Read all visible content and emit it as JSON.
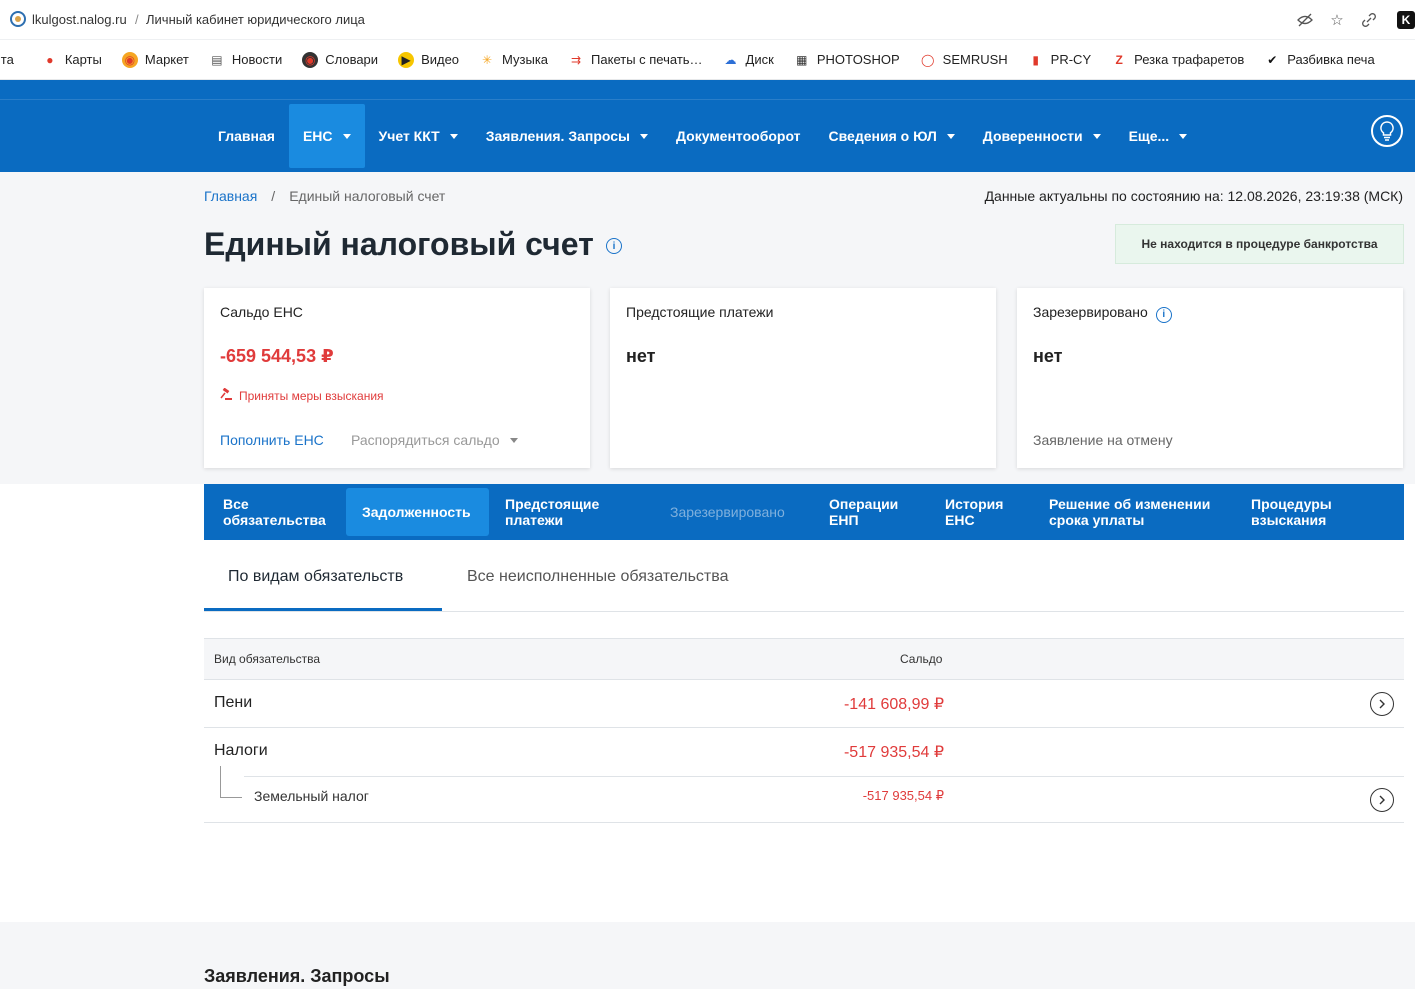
{
  "browser": {
    "domain": "lkulgost.nalog.ru",
    "separator": "/",
    "title": "Личный кабинет юридического лица"
  },
  "bookmarks": [
    {
      "label": "чта",
      "icon": "mail-icon"
    },
    {
      "label": "Карты",
      "icon": "map-pin-icon"
    },
    {
      "label": "Маркет",
      "icon": "market-icon"
    },
    {
      "label": "Новости",
      "icon": "news-icon"
    },
    {
      "label": "Словари",
      "icon": "dictionary-icon"
    },
    {
      "label": "Видео",
      "icon": "video-icon"
    },
    {
      "label": "Музыка",
      "icon": "music-icon"
    },
    {
      "label": "Пакеты с печать…",
      "icon": "package-icon"
    },
    {
      "label": "Диск",
      "icon": "disk-icon"
    },
    {
      "label": "PHOTOSHOP",
      "icon": "photoshop-icon"
    },
    {
      "label": "SEMRUSH",
      "icon": "semrush-icon"
    },
    {
      "label": "PR-CY",
      "icon": "prcy-icon"
    },
    {
      "label": "Резка трафаретов",
      "icon": "stencil-icon"
    },
    {
      "label": "Разбивка печа",
      "icon": "bird-icon"
    }
  ],
  "nav": {
    "items": [
      {
        "label": "Главная",
        "dropdown": false,
        "active": false
      },
      {
        "label": "ЕНС",
        "dropdown": true,
        "active": true
      },
      {
        "label": "Учет ККТ",
        "dropdown": true,
        "active": false
      },
      {
        "label": "Заявления. Запросы",
        "dropdown": true,
        "active": false
      },
      {
        "label": "Документооборот",
        "dropdown": false,
        "active": false
      },
      {
        "label": "Сведения о ЮЛ",
        "dropdown": true,
        "active": false
      },
      {
        "label": "Доверенности",
        "dropdown": true,
        "active": false
      },
      {
        "label": "Еще...",
        "dropdown": true,
        "active": false
      }
    ],
    "colors": {
      "primary": "#0a6bc1",
      "active": "#1a8be0"
    }
  },
  "breadcrumb": {
    "home": "Главная",
    "separator": "/",
    "current": "Единый налоговый счет"
  },
  "actual_status": "Данные актуальны по состоянию на: 12.08.2026, 23:19:38 (МСК)",
  "page_title": "Единый налоговый счет",
  "info_glyph": "i",
  "bankrupt_badge": "Не находится в процедуре банкротства",
  "cards": {
    "saldo": {
      "title": "Сальдо ЕНС",
      "value": "-659 544,53 ₽",
      "warning": "Приняты меры взыскания",
      "topup": "Пополнить ЕНС",
      "manage": "Распорядиться сальдо"
    },
    "upcoming": {
      "title": "Предстоящие платежи",
      "value": "нет"
    },
    "reserved": {
      "title": "Зарезервировано",
      "value": "нет",
      "cancel": "Заявление на отмену"
    }
  },
  "tabs": [
    {
      "label": "Все обязательства",
      "state": "normal"
    },
    {
      "label": "Задолженность",
      "state": "active"
    },
    {
      "label": "Предстоящие платежи",
      "state": "normal"
    },
    {
      "label": "Зарезервировано",
      "state": "disabled"
    },
    {
      "label": "Операции ЕНП",
      "state": "normal"
    },
    {
      "label": "История ЕНС",
      "state": "normal"
    },
    {
      "label": "Решение об изменении срока уплаты",
      "state": "normal"
    },
    {
      "label": "Процедуры взыскания",
      "state": "normal"
    }
  ],
  "subtabs": {
    "active": "По видам обязательств",
    "inactive": "Все неисполненные обязательства"
  },
  "table": {
    "headers": {
      "kind": "Вид обязательства",
      "saldo": "Сальдо"
    },
    "rows": [
      {
        "name": "Пени",
        "value": "-141 608,99 ₽"
      },
      {
        "name": "Налоги",
        "value": "-517 935,54 ₽"
      }
    ],
    "subrows": [
      {
        "name": "Земельный налог",
        "value": "-517 935,54 ₽"
      }
    ]
  },
  "bottom_section": {
    "title": "Заявления. Запросы"
  }
}
